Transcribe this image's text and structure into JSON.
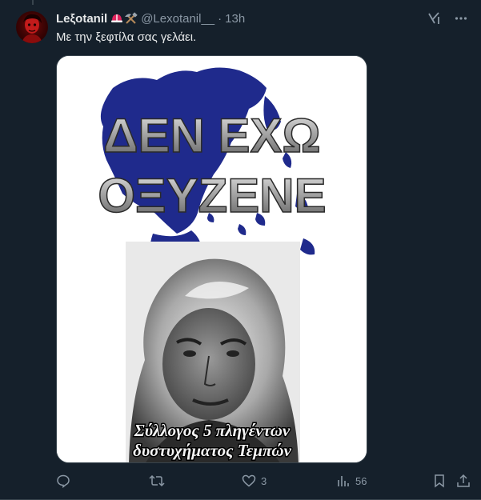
{
  "tweet": {
    "author_name": "Leξotanil",
    "author_handle": "@Lexotanil__",
    "separator": "·",
    "time": "13h",
    "text": "Με την ξεφτίλα σας γελάει.",
    "emoji_icons": [
      "helmet-icon",
      "hammer-pick-icon"
    ]
  },
  "media": {
    "headline_line1": "ΔΕΝ ΕΧΩ",
    "headline_line2": "ΟΞΥΖΕΝΕ",
    "caption_line1": "Σύλλογος 5 πληγέντων",
    "caption_line2": "δυστυχήματος Τεμπών",
    "map_color": "#1f2a8c"
  },
  "actions": {
    "reply_count": "",
    "retweet_count": "",
    "like_count": "3",
    "views_count": "56"
  },
  "colors": {
    "background": "#15202b",
    "text": "#e7e9ea",
    "muted": "#8b98a5",
    "border": "#38444d"
  }
}
